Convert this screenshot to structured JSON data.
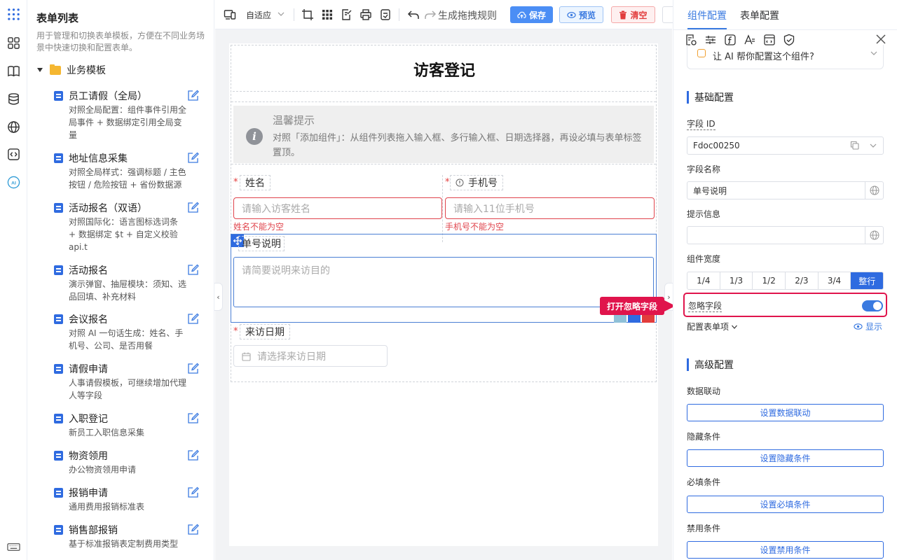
{
  "left_panel": {
    "title": "表单列表",
    "description": "用于管理和切换表单模板，方便在不同业务场景中快速切换和配置表单。",
    "folder": "业务模板",
    "templates": [
      {
        "name": "员工请假（全局）",
        "desc": "对照全局配置：组件事件引用全局事件 + 数据绑定引用全局变量"
      },
      {
        "name": "地址信息采集",
        "desc": "对照全局样式：强调标题 / 主色按钮 / 危险按钮 + 省份数据源"
      },
      {
        "name": "活动报名（双语）",
        "desc": "对照国际化：语言图标选词条 + 数据绑定 $t + 自定义校验 api.t"
      },
      {
        "name": "活动报名",
        "desc": "演示弹窗、抽屉模块：须知、选品回填、补充材料"
      },
      {
        "name": "会议报名",
        "desc": "对照 AI 一句话生成：姓名、手机号、公司、是否用餐"
      },
      {
        "name": "请假申请",
        "desc": "人事请假模板，可继续增加代理人等字段"
      },
      {
        "name": "入职登记",
        "desc": "新员工入职信息采集"
      },
      {
        "name": "物资领用",
        "desc": "办公物资领用申请"
      },
      {
        "name": "报销申请",
        "desc": "通用费用报销标准表"
      },
      {
        "name": "销售部报销",
        "desc": "基于标准报销表定制费用类型"
      }
    ]
  },
  "toolbar": {
    "layout_select": "自适应",
    "drag_rule_label": "生成拖拽规则",
    "save_label": "保存",
    "preview_label": "预览",
    "clear_label": "清空"
  },
  "form": {
    "title": "访客登记",
    "tip_title": "温馨提示",
    "tip_text": "对照「添加组件」：从组件列表拖入输入框、多行输入框、日期选择器，再设必填与表单标签置顶。",
    "name_label": "姓名",
    "name_placeholder": "请输入访客姓名",
    "name_error": "姓名不能为空",
    "phone_label": "手机号",
    "phone_placeholder": "请输入11位手机号",
    "phone_error": "手机号不能为空",
    "remark_label": "单号说明",
    "remark_placeholder": "请简要说明来访目的",
    "date_label": "来访日期",
    "date_placeholder": "请选择来访日期"
  },
  "callout": "打开忽略字段",
  "right_panel": {
    "tab_component": "组件配置",
    "tab_form": "表单配置",
    "ai_prompt": "让 AI 帮你配置这个组件?",
    "basic_section": "基础配置",
    "field_id_label": "字段 ID",
    "field_id_value": "Fdoc00250",
    "field_name_label": "字段名称",
    "field_name_value": "单号说明",
    "hint_label": "提示信息",
    "hint_value": "",
    "width_label": "组件宽度",
    "width_options": [
      "1/4",
      "1/3",
      "1/2",
      "2/3",
      "3/4",
      "整行"
    ],
    "width_selected": "整行",
    "ignore_label": "忽略字段",
    "ignore_on": true,
    "config_items_label": "配置表单项",
    "show_label": "显示",
    "advanced_section": "高级配置",
    "data_link_label": "数据联动",
    "data_link_btn": "设置数据联动",
    "hide_label": "隐藏条件",
    "hide_btn": "设置隐藏条件",
    "required_label": "必填条件",
    "required_btn": "设置必填条件",
    "disable_label": "禁用条件",
    "disable_btn": "设置禁用条件"
  }
}
